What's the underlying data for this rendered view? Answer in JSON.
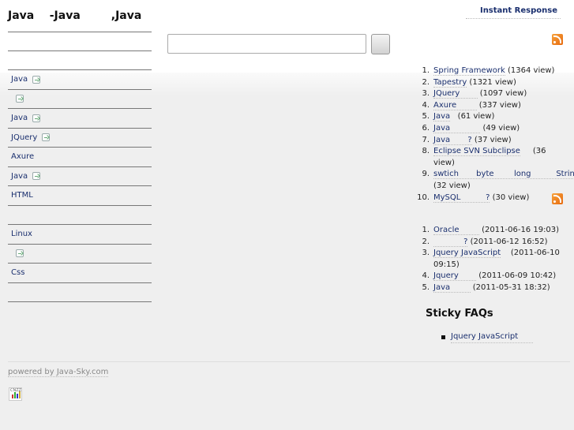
{
  "header": {
    "site_title": "Java    -Java        ,Java",
    "instant_response": "Instant Response"
  },
  "search": {
    "placeholder": "",
    "button_label": ""
  },
  "nav": {
    "items": [
      {
        "label": "",
        "arrow": false
      },
      {
        "label": "",
        "arrow": false
      },
      {
        "label": "Java",
        "arrow": true
      },
      {
        "label": "",
        "arrow": true
      },
      {
        "label": "Java",
        "arrow": true
      },
      {
        "label": "JQuery",
        "arrow": true
      },
      {
        "label": "Axure",
        "arrow": false
      },
      {
        "label": "Java",
        "arrow": true
      },
      {
        "label": "HTML",
        "arrow": false
      },
      {
        "label": "",
        "arrow": false
      },
      {
        "label": "Linux",
        "arrow": false
      },
      {
        "label": "",
        "arrow": true
      },
      {
        "label": "Css",
        "arrow": false
      },
      {
        "label": "",
        "arrow": false
      }
    ]
  },
  "popular": [
    {
      "n": "1.",
      "title": "Spring Framework",
      "meta": " (1364 view)"
    },
    {
      "n": "2.",
      "title": "Tapestry",
      "meta": " (1321 view)"
    },
    {
      "n": "3.",
      "title": "JQuery       ",
      "meta": " (1097 view)"
    },
    {
      "n": "4.",
      "title": "Axure        ",
      "meta": " (337 view)"
    },
    {
      "n": "5.",
      "title": "Java",
      "meta": "   (61 view)"
    },
    {
      "n": "6.",
      "title": "Java            ",
      "meta": " (49 view)"
    },
    {
      "n": "7.",
      "title": "Java       ?",
      "meta": " (37 view)"
    },
    {
      "n": "8.",
      "title": "Eclipse SVN Subclipse",
      "meta": "     (36 view)"
    },
    {
      "n": "9.",
      "title": "swtich       byte        long          String",
      "meta": " (32 view)"
    },
    {
      "n": "10.",
      "title": "MySQL          ?",
      "meta": " (30 view)"
    }
  ],
  "recent": [
    {
      "n": "1.",
      "title": "Oracle        ",
      "meta": " (2011-06-16 19:03)"
    },
    {
      "n": "2.",
      "title": "            ?",
      "meta": " (2011-06-12 16:52)"
    },
    {
      "n": "3.",
      "title": "Jquery JavaScript",
      "meta": "    (2011-06-10 09:15)"
    },
    {
      "n": "4.",
      "title": "Jquery       ",
      "meta": " (2011-06-09 10:42)"
    },
    {
      "n": "5.",
      "title": "Java        ",
      "meta": " (2011-05-31 18:32)"
    }
  ],
  "sticky": {
    "title": "Sticky FAQs",
    "items": [
      {
        "title": "Jquery JavaScript      "
      }
    ]
  },
  "footer": {
    "powered_prefix": "powered by ",
    "powered_site": "Java-Sky.com",
    "counter_label": "CNZZ"
  },
  "colors": {
    "link": "#1a2f6e",
    "rss": "#f08020",
    "background": "#efefef"
  }
}
